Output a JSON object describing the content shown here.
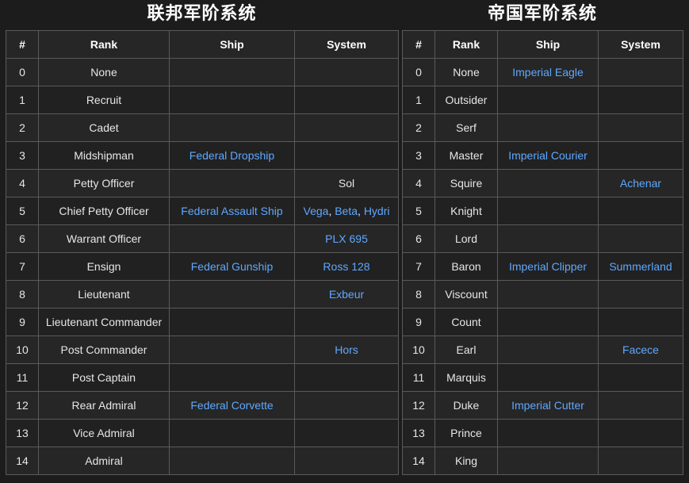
{
  "federal": {
    "title": "联邦军阶系统",
    "headers": {
      "num": "#",
      "rank": "Rank",
      "ship": "Ship",
      "system": "System"
    },
    "rows": [
      {
        "num": "0",
        "rank": "None"
      },
      {
        "num": "1",
        "rank": "Recruit"
      },
      {
        "num": "2",
        "rank": "Cadet"
      },
      {
        "num": "3",
        "rank": "Midshipman",
        "ship": "Federal Dropship"
      },
      {
        "num": "4",
        "rank": "Petty Officer",
        "system_text": "Sol"
      },
      {
        "num": "5",
        "rank": "Chief Petty Officer",
        "ship": "Federal Assault Ship",
        "system_a": "Vega",
        "system_b": "Beta",
        "system_c": "Hydri"
      },
      {
        "num": "6",
        "rank": "Warrant Officer",
        "system": "PLX 695"
      },
      {
        "num": "7",
        "rank": "Ensign",
        "ship": "Federal Gunship",
        "system": "Ross 128"
      },
      {
        "num": "8",
        "rank": "Lieutenant",
        "system": "Exbeur"
      },
      {
        "num": "9",
        "rank": "Lieutenant Commander"
      },
      {
        "num": "10",
        "rank": "Post Commander",
        "system": "Hors"
      },
      {
        "num": "11",
        "rank": "Post Captain"
      },
      {
        "num": "12",
        "rank": "Rear Admiral",
        "ship": "Federal Corvette"
      },
      {
        "num": "13",
        "rank": "Vice Admiral"
      },
      {
        "num": "14",
        "rank": "Admiral"
      }
    ],
    "separator": ","
  },
  "imperial": {
    "title": "帝国军阶系统",
    "headers": {
      "num": "#",
      "rank": "Rank",
      "ship": "Ship",
      "system": "System"
    },
    "rows": [
      {
        "num": "0",
        "rank": "None",
        "ship": "Imperial Eagle"
      },
      {
        "num": "1",
        "rank": "Outsider"
      },
      {
        "num": "2",
        "rank": "Serf"
      },
      {
        "num": "3",
        "rank": "Master",
        "ship": "Imperial Courier"
      },
      {
        "num": "4",
        "rank": "Squire",
        "system": "Achenar"
      },
      {
        "num": "5",
        "rank": "Knight"
      },
      {
        "num": "6",
        "rank": "Lord"
      },
      {
        "num": "7",
        "rank": "Baron",
        "ship": "Imperial Clipper",
        "system": "Summerland"
      },
      {
        "num": "8",
        "rank": "Viscount"
      },
      {
        "num": "9",
        "rank": "Count"
      },
      {
        "num": "10",
        "rank": "Earl",
        "system": "Facece"
      },
      {
        "num": "11",
        "rank": "Marquis"
      },
      {
        "num": "12",
        "rank": "Duke",
        "ship": "Imperial Cutter"
      },
      {
        "num": "13",
        "rank": "Prince"
      },
      {
        "num": "14",
        "rank": "King"
      }
    ]
  },
  "colors": {
    "background": "#1c1c1c",
    "border": "#5a5a5a",
    "link": "#5fa8ff",
    "text": "#e6e6e6"
  }
}
